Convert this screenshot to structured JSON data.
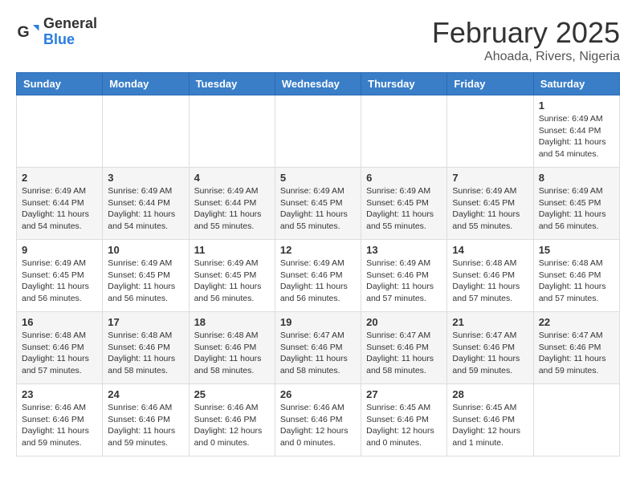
{
  "logo": {
    "general": "General",
    "blue": "Blue"
  },
  "header": {
    "month": "February 2025",
    "location": "Ahoada, Rivers, Nigeria"
  },
  "weekdays": [
    "Sunday",
    "Monday",
    "Tuesday",
    "Wednesday",
    "Thursday",
    "Friday",
    "Saturday"
  ],
  "weeks": [
    [
      {
        "day": "",
        "info": ""
      },
      {
        "day": "",
        "info": ""
      },
      {
        "day": "",
        "info": ""
      },
      {
        "day": "",
        "info": ""
      },
      {
        "day": "",
        "info": ""
      },
      {
        "day": "",
        "info": ""
      },
      {
        "day": "1",
        "info": "Sunrise: 6:49 AM\nSunset: 6:44 PM\nDaylight: 11 hours and 54 minutes."
      }
    ],
    [
      {
        "day": "2",
        "info": "Sunrise: 6:49 AM\nSunset: 6:44 PM\nDaylight: 11 hours and 54 minutes."
      },
      {
        "day": "3",
        "info": "Sunrise: 6:49 AM\nSunset: 6:44 PM\nDaylight: 11 hours and 54 minutes."
      },
      {
        "day": "4",
        "info": "Sunrise: 6:49 AM\nSunset: 6:44 PM\nDaylight: 11 hours and 55 minutes."
      },
      {
        "day": "5",
        "info": "Sunrise: 6:49 AM\nSunset: 6:45 PM\nDaylight: 11 hours and 55 minutes."
      },
      {
        "day": "6",
        "info": "Sunrise: 6:49 AM\nSunset: 6:45 PM\nDaylight: 11 hours and 55 minutes."
      },
      {
        "day": "7",
        "info": "Sunrise: 6:49 AM\nSunset: 6:45 PM\nDaylight: 11 hours and 55 minutes."
      },
      {
        "day": "8",
        "info": "Sunrise: 6:49 AM\nSunset: 6:45 PM\nDaylight: 11 hours and 56 minutes."
      }
    ],
    [
      {
        "day": "9",
        "info": "Sunrise: 6:49 AM\nSunset: 6:45 PM\nDaylight: 11 hours and 56 minutes."
      },
      {
        "day": "10",
        "info": "Sunrise: 6:49 AM\nSunset: 6:45 PM\nDaylight: 11 hours and 56 minutes."
      },
      {
        "day": "11",
        "info": "Sunrise: 6:49 AM\nSunset: 6:45 PM\nDaylight: 11 hours and 56 minutes."
      },
      {
        "day": "12",
        "info": "Sunrise: 6:49 AM\nSunset: 6:46 PM\nDaylight: 11 hours and 56 minutes."
      },
      {
        "day": "13",
        "info": "Sunrise: 6:49 AM\nSunset: 6:46 PM\nDaylight: 11 hours and 57 minutes."
      },
      {
        "day": "14",
        "info": "Sunrise: 6:48 AM\nSunset: 6:46 PM\nDaylight: 11 hours and 57 minutes."
      },
      {
        "day": "15",
        "info": "Sunrise: 6:48 AM\nSunset: 6:46 PM\nDaylight: 11 hours and 57 minutes."
      }
    ],
    [
      {
        "day": "16",
        "info": "Sunrise: 6:48 AM\nSunset: 6:46 PM\nDaylight: 11 hours and 57 minutes."
      },
      {
        "day": "17",
        "info": "Sunrise: 6:48 AM\nSunset: 6:46 PM\nDaylight: 11 hours and 58 minutes."
      },
      {
        "day": "18",
        "info": "Sunrise: 6:48 AM\nSunset: 6:46 PM\nDaylight: 11 hours and 58 minutes."
      },
      {
        "day": "19",
        "info": "Sunrise: 6:47 AM\nSunset: 6:46 PM\nDaylight: 11 hours and 58 minutes."
      },
      {
        "day": "20",
        "info": "Sunrise: 6:47 AM\nSunset: 6:46 PM\nDaylight: 11 hours and 58 minutes."
      },
      {
        "day": "21",
        "info": "Sunrise: 6:47 AM\nSunset: 6:46 PM\nDaylight: 11 hours and 59 minutes."
      },
      {
        "day": "22",
        "info": "Sunrise: 6:47 AM\nSunset: 6:46 PM\nDaylight: 11 hours and 59 minutes."
      }
    ],
    [
      {
        "day": "23",
        "info": "Sunrise: 6:46 AM\nSunset: 6:46 PM\nDaylight: 11 hours and 59 minutes."
      },
      {
        "day": "24",
        "info": "Sunrise: 6:46 AM\nSunset: 6:46 PM\nDaylight: 11 hours and 59 minutes."
      },
      {
        "day": "25",
        "info": "Sunrise: 6:46 AM\nSunset: 6:46 PM\nDaylight: 12 hours and 0 minutes."
      },
      {
        "day": "26",
        "info": "Sunrise: 6:46 AM\nSunset: 6:46 PM\nDaylight: 12 hours and 0 minutes."
      },
      {
        "day": "27",
        "info": "Sunrise: 6:45 AM\nSunset: 6:46 PM\nDaylight: 12 hours and 0 minutes."
      },
      {
        "day": "28",
        "info": "Sunrise: 6:45 AM\nSunset: 6:46 PM\nDaylight: 12 hours and 1 minute."
      },
      {
        "day": "",
        "info": ""
      }
    ]
  ]
}
